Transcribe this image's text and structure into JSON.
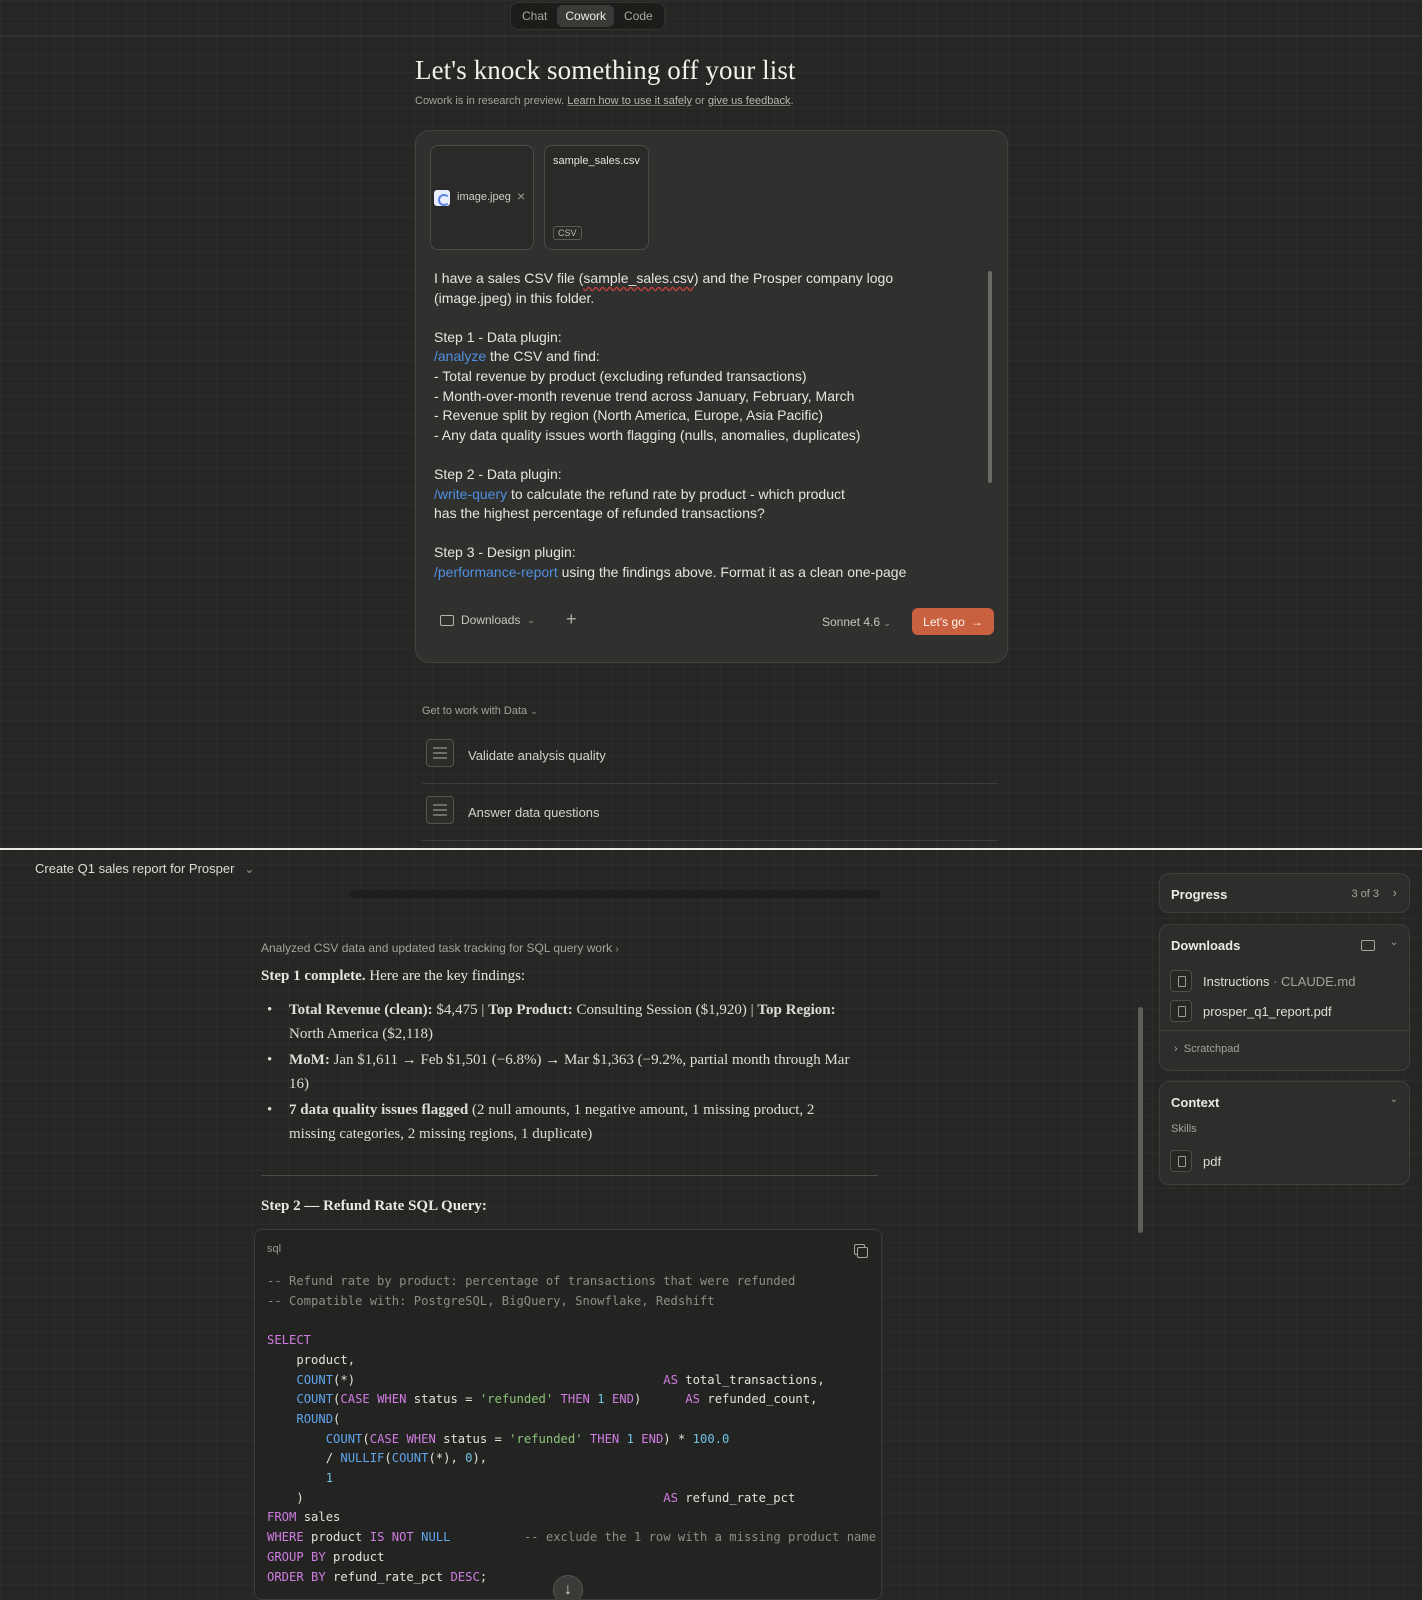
{
  "mode_tabs": [
    "Chat",
    "Cowork",
    "Code"
  ],
  "hero": {
    "title": "Let's knock something off your list",
    "sub_prefix": "Cowork is in research preview.",
    "sub_link1": "Learn how to use it safely",
    "sub_or": "or",
    "sub_link2": "give us feedback"
  },
  "composer": {
    "attachments": [
      {
        "name": "image.jpeg",
        "icon": "image-icon"
      },
      {
        "name": "sample_sales.csv",
        "badge": "CSV"
      }
    ],
    "prompt": {
      "line1_a": "I have a sales CSV file (",
      "line1_file": "sample_sales.csv",
      "line1_b": ") and the Prosper company logo",
      "line2": "(image.jpeg) in this folder.",
      "step1_title": "Step 1 - Data plugin:",
      "step1_cmd": "/analyze",
      "step1_rest": " the CSV and find:",
      "step1_items": [
        "- Total revenue by product (excluding refunded transactions)",
        "- Month-over-month revenue trend across January, February, March",
        "- Revenue split by region (North America, Europe, Asia Pacific)",
        "- Any data quality issues worth flagging (nulls, anomalies, duplicates)"
      ],
      "step2_title": "Step 2 - Data plugin:",
      "step2_cmd": "/write-query",
      "step2_rest": " to calculate the refund rate by product - which product",
      "step2_line2": "has the highest percentage of refunded transactions?",
      "step3_title": "Step 3 - Design plugin:",
      "step3_cmd": "/performance-report",
      "step3_rest": " using the findings above. Format it as a clean one-page"
    },
    "folder_label": "Downloads",
    "model_label": "Sonnet 4.6",
    "go_label": "Let's go"
  },
  "get_to_work": "Get to work with Data",
  "suggestions": [
    "Validate analysis quality",
    "Answer data questions"
  ],
  "task": {
    "title": "Create Q1 sales report for Prosper",
    "analyzed": "Analyzed CSV data and updated task tracking for SQL query work",
    "step1_bold": "Step 1 complete.",
    "step1_rest": " Here are the key findings:",
    "b1_bold1": "Total Revenue (clean):",
    "b1_t1": " $4,475 | ",
    "b1_bold2": "Top Product:",
    "b1_t2": " Consulting Session ($1,920) | ",
    "b1_bold3": "Top Region:",
    "b1_t3": " North America ($2,118)",
    "b2_bold": "MoM:",
    "b2_text": " Jan $1,611 → Feb $1,501 (−6.8%) → Mar $1,363 (−9.2%, partial month through Mar 16)",
    "b3_bold": "7 data quality issues flagged",
    "b3_text": " (2 null amounts, 1 negative amount, 1 missing product, 2 missing categories, 2 missing regions, 1 duplicate)",
    "step2_heading": "Step 2 — Refund Rate SQL Query:",
    "code_lang": "sql"
  },
  "panels": {
    "progress": {
      "title": "Progress",
      "count": "3 of 3"
    },
    "downloads": {
      "title": "Downloads",
      "file1_name": "Instructions",
      "file1_sep": " · ",
      "file1_sub": "CLAUDE.md",
      "file2": "prosper_q1_report.pdf",
      "scratchpad": "Scratchpad"
    },
    "context": {
      "title": "Context",
      "skills_label": "Skills",
      "skill": "pdf"
    }
  },
  "colors": {
    "accent": "#c9603f",
    "slash_command": "#4f8fe0",
    "background": "#262625"
  }
}
